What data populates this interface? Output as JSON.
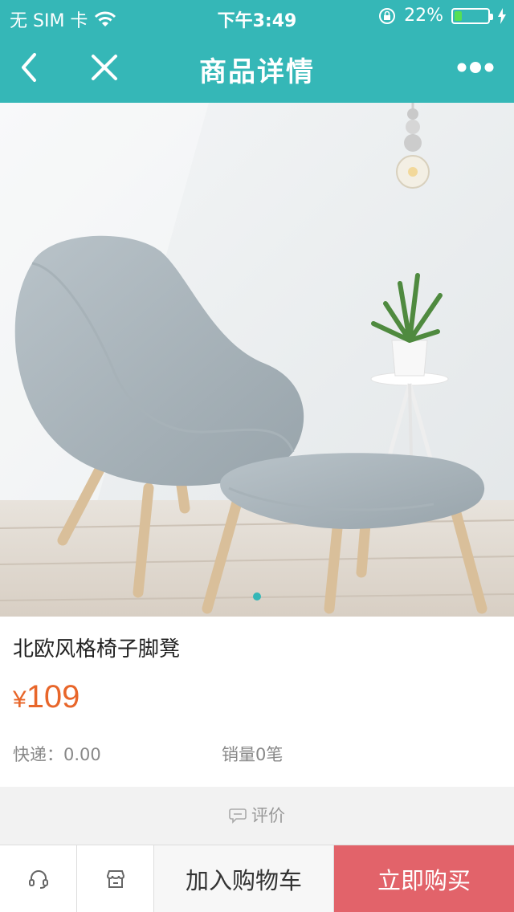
{
  "status_bar": {
    "carrier": "无 SIM 卡",
    "time": "下午3:49",
    "battery": "22%",
    "battery_level": 0.22
  },
  "navbar": {
    "title": "商品详情",
    "back_icon": "chevron-left-icon",
    "close_icon": "close-icon",
    "more_icon": "more-dots-icon"
  },
  "product": {
    "name": "北欧风格椅子脚凳",
    "currency": "¥",
    "price": "109",
    "shipping": "快递：0.00",
    "sales": "销量0笔",
    "image_count": 1,
    "current_image": 1
  },
  "review": {
    "label": "评价",
    "icon": "comment-icon"
  },
  "bottom_bar": {
    "service_icon": "headset-icon",
    "shop_icon": "shop-icon",
    "add_to_cart": "加入购物车",
    "buy_now": "立即购买"
  },
  "colors": {
    "accent": "#35b7b7",
    "price": "#e8662a",
    "buy_button": "#e2636a"
  }
}
